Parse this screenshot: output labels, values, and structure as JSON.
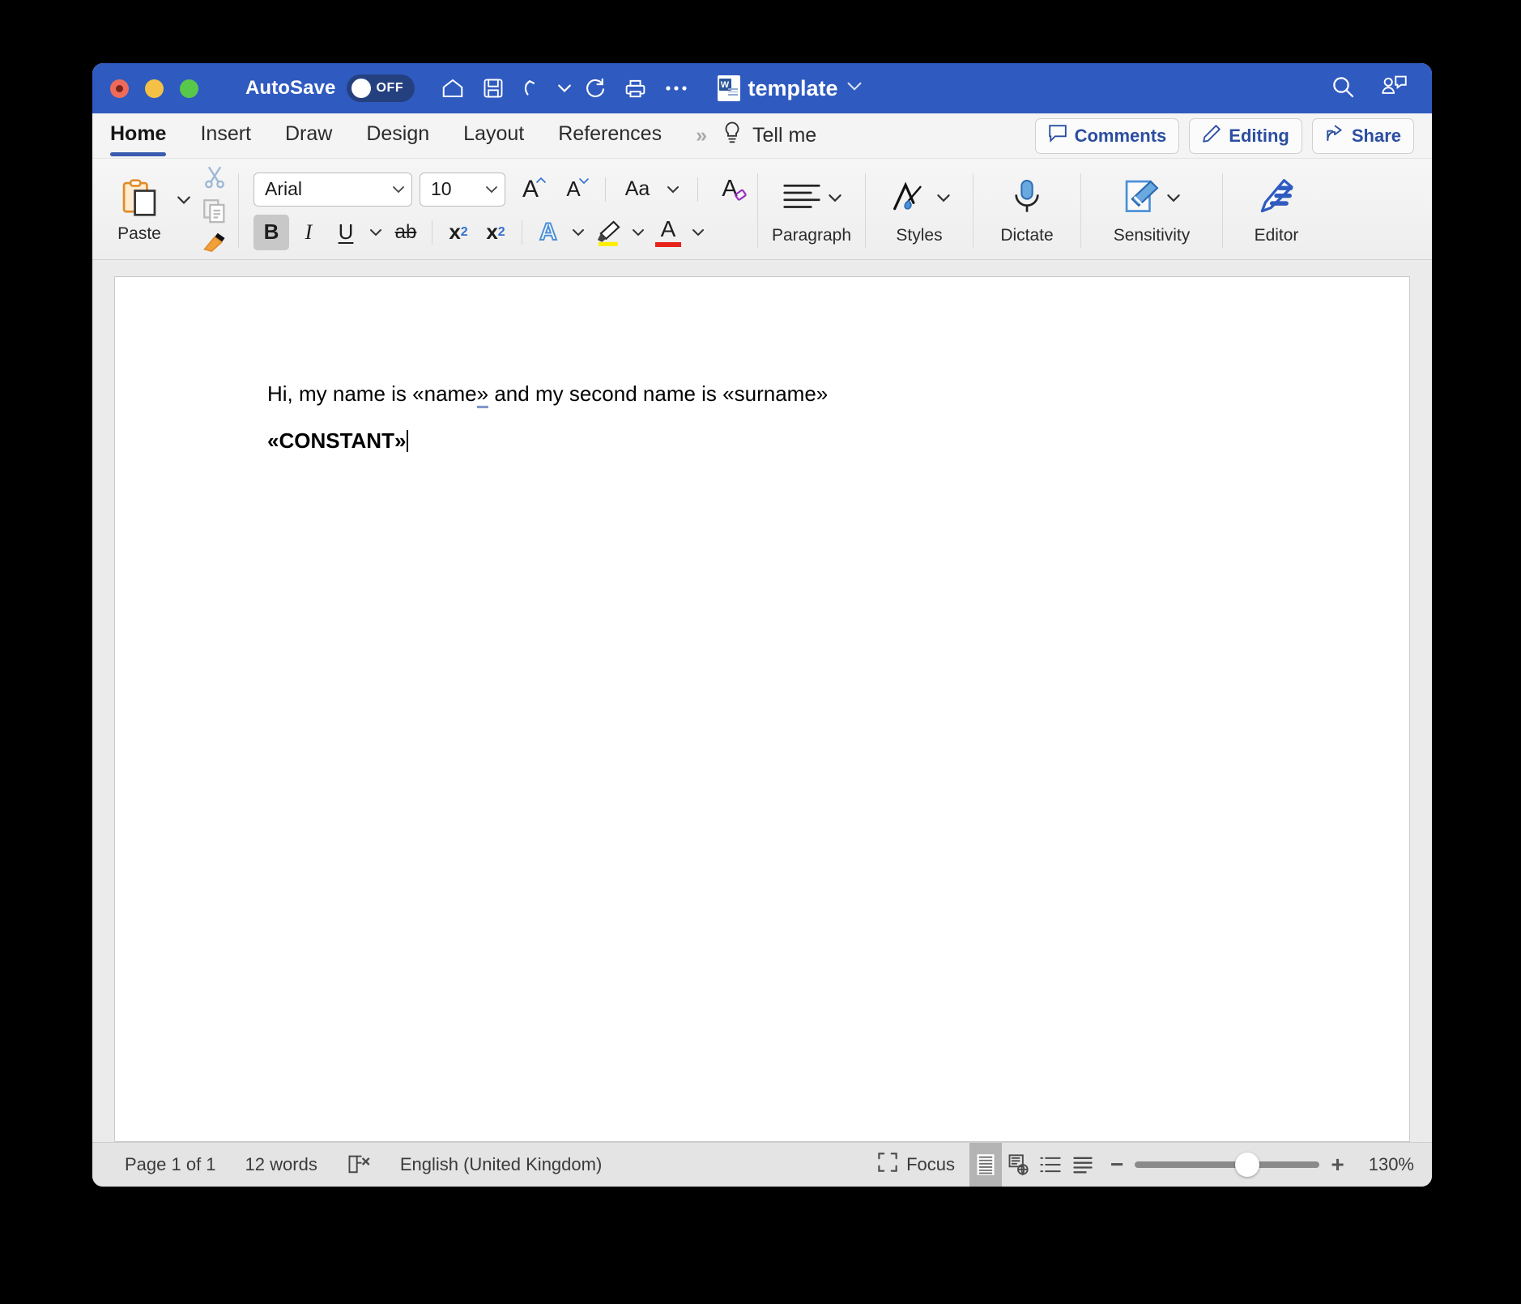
{
  "titlebar": {
    "autosave_label": "AutoSave",
    "autosave_state": "OFF",
    "doc_title": "template",
    "word_badge": "W",
    "icons": [
      "home-icon",
      "save-icon",
      "undo-icon",
      "redo-icon",
      "print-icon",
      "more-icon"
    ],
    "right_icons": [
      "search-icon",
      "collaborators-icon"
    ],
    "color": "#2f5ac0"
  },
  "tabs": [
    {
      "label": "Home",
      "active": true
    },
    {
      "label": "Insert",
      "active": false
    },
    {
      "label": "Draw",
      "active": false
    },
    {
      "label": "Design",
      "active": false
    },
    {
      "label": "Layout",
      "active": false
    },
    {
      "label": "References",
      "active": false
    }
  ],
  "tab_overflow": "»",
  "tellme": {
    "label": "Tell me"
  },
  "tab_actions": [
    {
      "label": "Comments",
      "icon": "comment-icon"
    },
    {
      "label": "Editing",
      "icon": "pencil-icon"
    },
    {
      "label": "Share",
      "icon": "share-icon"
    }
  ],
  "ribbon": {
    "clipboard": {
      "paste_label": "Paste",
      "cut_icon": "scissors-icon",
      "copy_icon": "copy-icon",
      "format_painter_icon": "paintbrush-icon"
    },
    "font": {
      "font_name": "Arial",
      "font_size": "10",
      "grow_font": "A",
      "shrink_font": "A",
      "change_case": "Aa",
      "clear_formatting": "A",
      "bold": "B",
      "bold_active": true,
      "italic": "I",
      "underline": "U",
      "strikethrough": "ab",
      "subscript": "x",
      "subscript_sup": "2",
      "superscript": "x",
      "superscript_sup": "2",
      "text_effects": "A",
      "highlight_icon": "highlighter-icon",
      "font_color": "A",
      "highlight_color": "#ffee00",
      "font_color_swatch": "#e8231c"
    },
    "groups": [
      {
        "label": "Paragraph",
        "icon": "paragraph-icon",
        "has_caret": true
      },
      {
        "label": "Styles",
        "icon": "styles-icon",
        "has_caret": true
      },
      {
        "label": "Dictate",
        "icon": "microphone-icon",
        "has_caret": false
      },
      {
        "label": "Sensitivity",
        "icon": "sensitivity-icon",
        "has_caret": true
      },
      {
        "label": "Editor",
        "icon": "editor-icon",
        "has_caret": false
      }
    ]
  },
  "document": {
    "line1_a": "Hi, my name is «name",
    "line1_b": "»",
    "line1_c": " and my second name is «surname»",
    "line2": "«CONSTANT»"
  },
  "statusbar": {
    "page": "Page 1 of 1",
    "words": "12 words",
    "proofing_icon": "proofing-errors-icon",
    "language": "English (United Kingdom)",
    "focus": "Focus",
    "view_icons": [
      "print-layout-icon",
      "web-layout-icon",
      "outline-icon",
      "draft-icon"
    ],
    "zoom_minus": "−",
    "zoom_plus": "+",
    "zoom_level": "130%"
  }
}
